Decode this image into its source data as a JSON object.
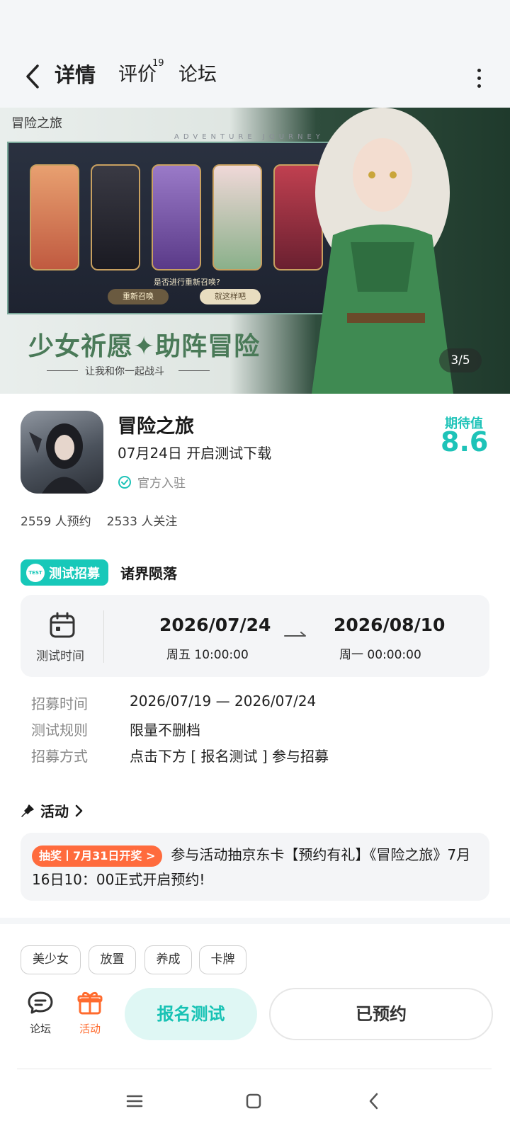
{
  "header": {
    "tabs": [
      {
        "label": "详情",
        "active": true
      },
      {
        "label": "评价"
      },
      {
        "label": "论坛"
      }
    ],
    "review_count": "19"
  },
  "banner": {
    "logo_text": "冒险之旅",
    "caption_en": "ADVENTURE JOURNEY",
    "prompt": "是否进行重新召唤?",
    "button_resummon": "重新召唤",
    "button_confirm": "就这样吧",
    "slogan": "少女祈愿✦助阵冒险",
    "subslogan": "让我和你一起战斗",
    "counter": "3/5"
  },
  "game": {
    "name": "冒险之旅",
    "release": "07月24日 开启测试下载",
    "verified": "官方入驻",
    "expect_label": "期待值",
    "expect_value": "8.6",
    "reservations": "2559 人预约",
    "followers": "2533 人关注",
    "accent": "#1ec3b8"
  },
  "recruit": {
    "badge": "测试招募",
    "badge_icon_text": "TEST",
    "title": "诸界陨落",
    "time_label": "测试时间",
    "start_date": "2026/07/24",
    "start_time": "周五  10:00:00",
    "end_date": "2026/08/10",
    "end_time": "周一  00:00:00",
    "rows": [
      {
        "key": "招募时间",
        "value": "2026/07/19 — 2026/07/24"
      },
      {
        "key": "测试规则",
        "value": "限量不删档"
      },
      {
        "key": "招募方式",
        "value": "点击下方 [ 报名测试 ] 参与招募"
      }
    ]
  },
  "activity": {
    "header": "活动",
    "tag": "抽奖丨7月31日开奖 >",
    "text": "参与活动抽京东卡【预约有礼】《冒险之旅》7月16日10：00正式开启预约!",
    "tag_color": "#ff6b3d"
  },
  "tags": [
    "美少女",
    "放置",
    "养成",
    "卡牌"
  ],
  "bottom": {
    "forum_label": "论坛",
    "activity_label": "活动",
    "register_button": "报名测试",
    "reserved_button": "已预约"
  }
}
